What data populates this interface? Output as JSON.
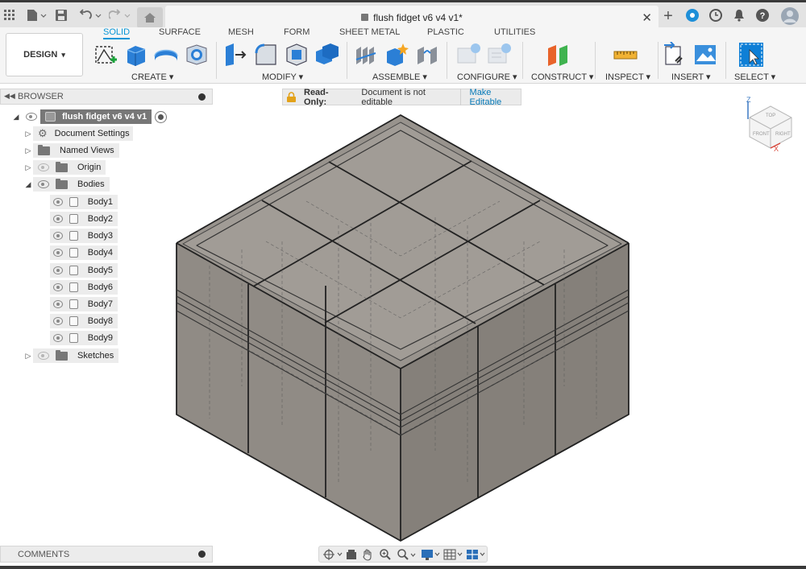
{
  "titlebar": {
    "doc_title": "flush fidget v6 v4 v1*",
    "icons": [
      "grid-icon",
      "file-icon",
      "save-icon",
      "undo-icon",
      "redo-icon",
      "home-icon",
      "lock-icon",
      "close-icon",
      "plus-icon",
      "extensions-icon",
      "clock-icon",
      "bell-icon",
      "help-icon",
      "avatar"
    ]
  },
  "workspace": {
    "design_label": "DESIGN",
    "tabs": [
      {
        "label": "SOLID",
        "active": true
      },
      {
        "label": "SURFACE",
        "active": false
      },
      {
        "label": "MESH",
        "active": false
      },
      {
        "label": "FORM",
        "active": false
      },
      {
        "label": "SHEET METAL",
        "active": false
      },
      {
        "label": "PLASTIC",
        "active": false
      },
      {
        "label": "UTILITIES",
        "active": false
      }
    ],
    "groups": [
      {
        "label": "CREATE ▾"
      },
      {
        "label": "MODIFY ▾"
      },
      {
        "label": "ASSEMBLE ▾"
      },
      {
        "label": "CONFIGURE ▾"
      },
      {
        "label": "CONSTRUCT ▾"
      },
      {
        "label": "INSPECT ▾"
      },
      {
        "label": "INSERT ▾"
      },
      {
        "label": "SELECT ▾"
      }
    ]
  },
  "browser": {
    "title": "BROWSER",
    "root": "flush fidget v6 v4 v1",
    "items": [
      {
        "label": "Document Settings"
      },
      {
        "label": "Named Views"
      },
      {
        "label": "Origin"
      },
      {
        "label": "Bodies"
      },
      {
        "label": "Sketches"
      }
    ],
    "bodies": [
      "Body1",
      "Body2",
      "Body3",
      "Body4",
      "Body5",
      "Body6",
      "Body7",
      "Body8",
      "Body9"
    ]
  },
  "banner": {
    "title": "Read-Only:",
    "message": "Document is not editable",
    "action": "Make Editable"
  },
  "viewcube": {
    "top": "TOP",
    "front": "FRONT",
    "right": "RIGHT",
    "z_axis": "Z",
    "x_axis": "X"
  },
  "comments": {
    "label": "COMMENTS"
  },
  "colors": {
    "accent": "#0696d7",
    "model_fill": "#8d8780",
    "panel": "#ececec"
  }
}
